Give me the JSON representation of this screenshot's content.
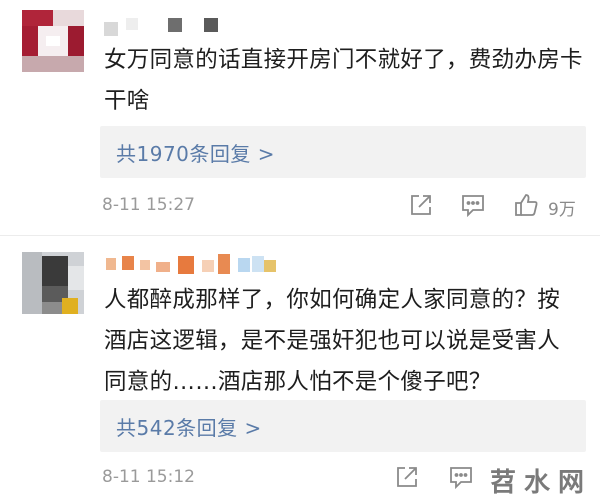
{
  "comments": [
    {
      "text": "女万同意的话直接开房门不就好了，费劲办房卡干啥",
      "reply_link": "共1970条回复 >",
      "time": "8-11 15:27",
      "likes": "9万"
    },
    {
      "text": "人都醉成那样了，你如何确定人家同意的？按酒店这逻辑，是不是强奸犯也可以说是受害人同意的……酒店那人怕不是个傻子吧？",
      "reply_link": "共542条回复 >",
      "time": "8-11 15:12",
      "likes": ""
    }
  ],
  "watermark": "苕水网",
  "icons": [
    "share-icon",
    "comment-icon",
    "like-icon"
  ],
  "colors": {
    "link": "#5a7ba8",
    "meta": "#9a9a9a",
    "reply_bg": "#f2f2f2"
  }
}
